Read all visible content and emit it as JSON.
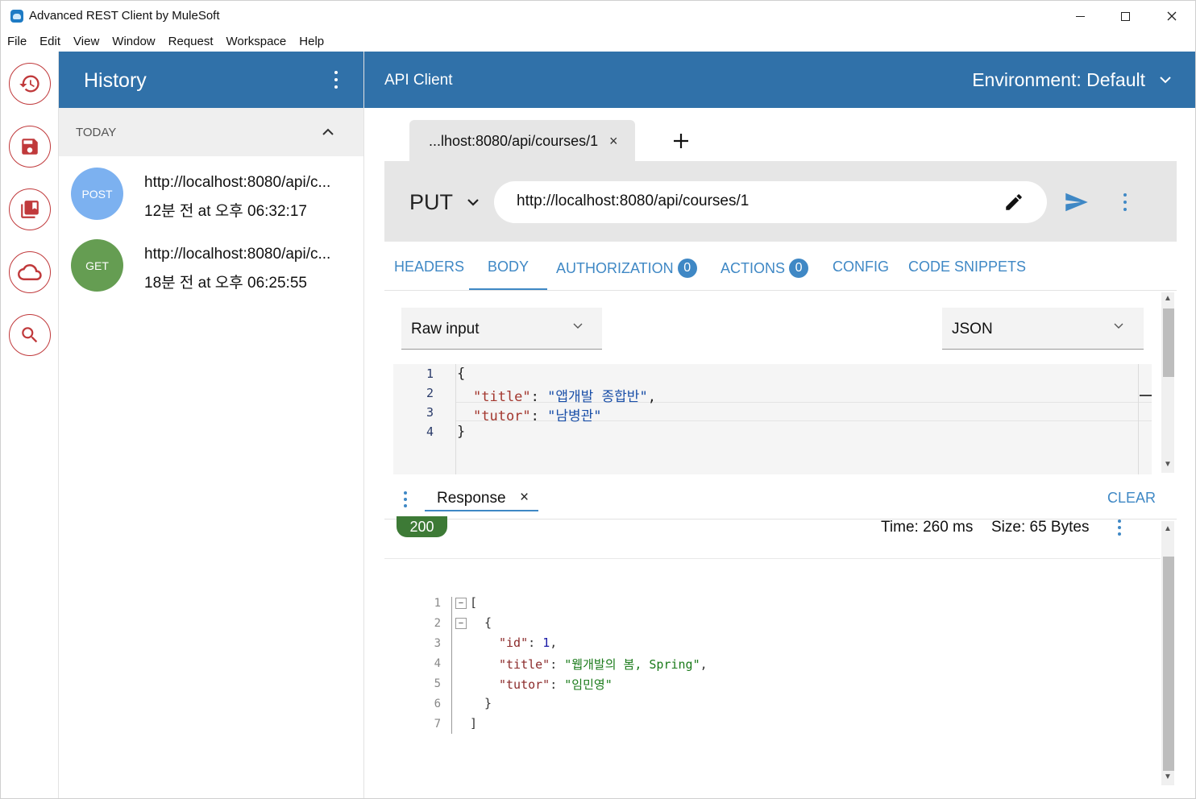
{
  "window": {
    "title": "Advanced REST Client by MuleSoft"
  },
  "menu": [
    "File",
    "Edit",
    "View",
    "Window",
    "Request",
    "Workspace",
    "Help"
  ],
  "history": {
    "title": "History",
    "group_label": "TODAY",
    "items": [
      {
        "method": "POST",
        "method_color": "#7cb1f0",
        "url": "http://localhost:8080/api/c...",
        "time": "12분 전 at 오후 06:32:17"
      },
      {
        "method": "GET",
        "method_color": "#659d52",
        "url": "http://localhost:8080/api/c...",
        "time": "18분 전 at 오후 06:25:55"
      }
    ]
  },
  "api": {
    "title": "API Client",
    "environment": "Environment: Default"
  },
  "request_tab": {
    "label": "...lhost:8080/api/courses/1",
    "close": "×"
  },
  "request": {
    "method": "PUT",
    "url": "http://localhost:8080/api/courses/1"
  },
  "config_tabs": [
    {
      "label": "HEADERS"
    },
    {
      "label": "BODY"
    },
    {
      "label": "AUTHORIZATION",
      "count": "0"
    },
    {
      "label": "ACTIONS",
      "count": "0"
    },
    {
      "label": "CONFIG"
    },
    {
      "label": "CODE SNIPPETS"
    }
  ],
  "body": {
    "editor_type": "Raw input",
    "content_type": "JSON",
    "lines": [
      {
        "n": "1",
        "text": "{"
      },
      {
        "n": "2",
        "key": "\"title\"",
        "sep": ": ",
        "value": "\"앱개발 종합반\"",
        "end": ","
      },
      {
        "n": "3",
        "key": "\"tutor\"",
        "sep": ": ",
        "value": "\"남병관\"",
        "end": ""
      },
      {
        "n": "4",
        "text": "}"
      }
    ]
  },
  "response": {
    "tab_label": "Response",
    "tab_close": "×",
    "clear_label": "CLEAR",
    "status": "200",
    "time": "Time: 260 ms",
    "size": "Size: 65 Bytes",
    "lines": [
      {
        "n": "1",
        "text": "["
      },
      {
        "n": "2",
        "text": "{"
      },
      {
        "n": "3",
        "key": "\"id\"",
        "sep": ": ",
        "value": "1",
        "end": ","
      },
      {
        "n": "4",
        "key": "\"title\"",
        "sep": ": ",
        "value": "\"웹개발의 봄, Spring\"",
        "end": ","
      },
      {
        "n": "5",
        "key": "\"tutor\"",
        "sep": ": ",
        "value": "\"임민영\"",
        "end": ""
      },
      {
        "n": "6",
        "text": "}"
      },
      {
        "n": "7",
        "text": "]"
      }
    ]
  },
  "colors": {
    "header_blue": "#3071a9",
    "accent_blue": "#3f88c5",
    "rail_red": "#c0393b",
    "status_green": "#3d7a36"
  },
  "icons": [
    "history-icon",
    "save-icon",
    "saved-requests-icon",
    "cloud-icon",
    "search-icon"
  ]
}
